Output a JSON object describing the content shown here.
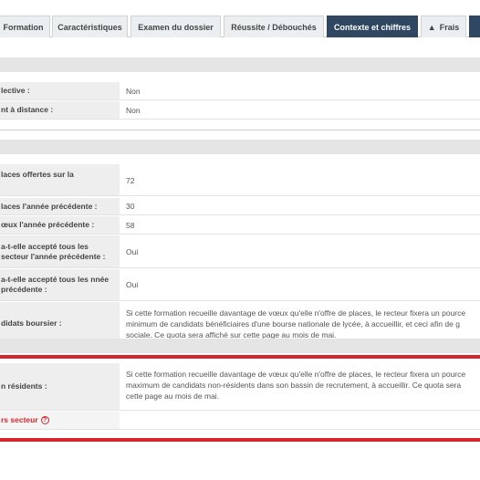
{
  "tabs": [
    {
      "label": "Formation"
    },
    {
      "label": "Caractéristiques"
    },
    {
      "label": "Examen du dossier"
    },
    {
      "label": "Réussite / Débouchés"
    },
    {
      "label": "Contexte et chiffres",
      "active": true
    },
    {
      "label": "Frais",
      "icon": "warning-icon"
    }
  ],
  "section1": {
    "rows": [
      {
        "label": "lective :",
        "value": "Non"
      },
      {
        "label": "nt à distance :",
        "value": "Non"
      }
    ]
  },
  "section2": {
    "rows": [
      {
        "label": "laces offertes sur la",
        "value": "72"
      },
      {
        "label": "laces l'année précédente :",
        "value": "30"
      },
      {
        "label": "œux l'année précédente :",
        "value": "58"
      },
      {
        "label": "a-t-elle accepté tous les secteur l'année précédente :",
        "value": "Oui"
      },
      {
        "label": "a-t-elle accepté tous les nnée précédente :",
        "value": "Oui"
      }
    ],
    "boursier": {
      "label": "didats boursier :",
      "lines": [
        "Si cette formation recueille davantage de vœux qu'elle n'offre de places, le recteur fixera un pource",
        "minimum de candidats bénéficiaires d'une bourse nationale de lycée, à accueillir, et ceci afin de g",
        "sociale. Ce quota sera affiché sur cette page au mois de mai."
      ]
    }
  },
  "section3": {
    "residents": {
      "label": "n résidents :",
      "lines": [
        "Si cette formation recueille davantage de vœux qu'elle n'offre de places, le recteur fixera un pource",
        "maximum de candidats non-résidents dans son bassin de recrutement, à accueillir. Ce quota sera",
        "cette page au mois de mai."
      ]
    },
    "hors_secteur": {
      "label": "rs secteur",
      "icon": "help-circle-icon"
    }
  },
  "colors": {
    "active_tab": "#2f4760",
    "accent_red": "#d6262e",
    "label_bg": "#eeeeee",
    "band_bg": "#e5e5e5"
  }
}
